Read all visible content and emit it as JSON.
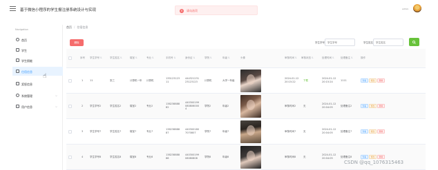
{
  "header": {
    "title": "基于微信小程序的学生报注册系统设计与实现",
    "alert": "请勾选项",
    "user": "admin"
  },
  "sidebar": {
    "heading": "Navigation",
    "items": [
      {
        "label": "首页",
        "icon": "home-icon"
      },
      {
        "label": "学生",
        "icon": "user-icon"
      },
      {
        "label": "学生照能",
        "icon": "photo-icon"
      },
      {
        "label": "住宿信息",
        "icon": "bed-icon"
      },
      {
        "label": "奖惩信息",
        "icon": "chart-icon"
      },
      {
        "label": "系统管理",
        "icon": "settings-icon"
      },
      {
        "label": "用户信息",
        "icon": "account-icon"
      }
    ]
  },
  "breadcrumb": {
    "home": "首页",
    "current": "住宿信息"
  },
  "search": {
    "field1_label": "学生学号",
    "field1_placeholder": "学生学号",
    "field2_label": "学生姓名",
    "field2_placeholder": "学生姓名"
  },
  "toolbar": {
    "delete_label": "删除"
  },
  "table": {
    "headers": [
      "序号",
      "学生学号",
      "学生姓名",
      "寝室",
      "专业",
      "手机号",
      "身份证",
      "学院",
      "年级",
      "头像",
      "审核时间",
      "审核状态",
      "处理时间",
      "处理备注",
      "操作"
    ],
    "actions": [
      "查看",
      "修改",
      "删除"
    ],
    "rows": [
      {
        "index": "1",
        "student_no": "11",
        "name": "张三",
        "dorm": "计算机一年",
        "major": "计算机",
        "phone": "13512312311",
        "id_card": "44432123123123123",
        "college": "计算机",
        "grade": "大学一年级",
        "audit_time": "2024-01-12 20:15:22",
        "status": "下载",
        "process_time": "2024-01-12 20:15:24",
        "remark": "1111"
      },
      {
        "index": "2",
        "student_no": "学生学号2",
        "name": "学生姓名2",
        "dorm": "寝室2",
        "major": "专业2",
        "phone": "13823888882",
        "id_card": "4403001990808060004",
        "college": "学院2",
        "grade": "年级2",
        "audit_time": "审核时间2",
        "status": "无",
        "process_time": "2024-01-12 20:04:05",
        "remark": "处理备注2"
      },
      {
        "index": "3",
        "student_no": "学生学号7",
        "name": "学生姓名7",
        "dorm": "寝室7",
        "major": "专业7",
        "phone": "13823888887",
        "id_card": "4403001807070807",
        "college": "学院7",
        "grade": "年级7",
        "audit_time": "审核时间7",
        "status": "无",
        "process_time": "2024-01-12 20:04:05",
        "remark": "处理备注7"
      },
      {
        "index": "4",
        "student_no": "学生学号8",
        "name": "学生姓名8",
        "dorm": "寝室8",
        "major": "专业8",
        "phone": "13823888888",
        "id_card": "44030019908080808",
        "college": "学院8",
        "grade": "年级8",
        "audit_time": "审核时间8",
        "status": "无",
        "process_time": "2024-01-12 20:04:05",
        "remark": "处理备注8"
      }
    ]
  },
  "watermark": "CSDN @qq_1076315463"
}
